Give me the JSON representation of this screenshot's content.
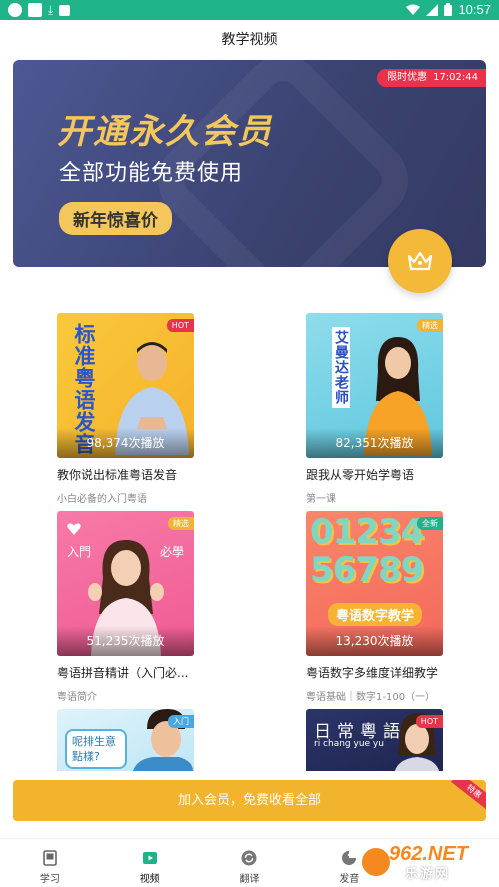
{
  "status_bar": {
    "time": "10:57",
    "left_icons": [
      "app-notification-icon",
      "square-notification-icon",
      "download-icon",
      "text-icon"
    ],
    "right_icons": [
      "wifi-icon",
      "signal-icon",
      "battery-icon"
    ]
  },
  "header": {
    "title": "教学视频"
  },
  "banner": {
    "title": "开通永久会员",
    "subtitle": "全部功能免费使用",
    "promo": "新年惊喜价",
    "timer_label": "限时优惠",
    "timer_value": "17:02:44",
    "fab_icon": "crown-icon"
  },
  "courses": [
    {
      "title": "教你说出标准粤语发音",
      "subtitle": "小白必备的入门粤语",
      "plays": "98,374次播放",
      "tag": "HOT",
      "thumb_text": "标准粤语发音"
    },
    {
      "title": "跟我从零开始学粤语",
      "subtitle": "第一课",
      "plays": "82,351次播放",
      "tag": "精选",
      "thumb_text": "艾曼达老师"
    },
    {
      "title": "粤语拼音精讲（入门必...",
      "subtitle": "粤语简介",
      "plays": "51,235次播放",
      "tag": "精选",
      "thumb_text_left": "入門",
      "thumb_text_right": "必學"
    },
    {
      "title": "粤语数字多维度详细教学",
      "subtitle": "粤语基础｜数字1-100（一）",
      "plays": "13,230次播放",
      "tag": "全新",
      "thumb_text": "粤语数字教学",
      "thumb_digits": "0123456789"
    },
    {
      "tag": "入门",
      "thumb_text": "呢排生意點樣?"
    },
    {
      "tag": "HOT",
      "thumb_text": "日常粵語",
      "thumb_subtext": "ri chang yue yu"
    }
  ],
  "join_bar": {
    "label": "加入会员，免费收看全部",
    "badge": "特惠"
  },
  "tabs": [
    {
      "label": "学习",
      "icon": "book-icon"
    },
    {
      "label": "视频",
      "icon": "video-icon",
      "active": true
    },
    {
      "label": "翻译",
      "icon": "translate-icon"
    },
    {
      "label": "发音",
      "icon": "pronunciation-icon"
    }
  ],
  "watermark": {
    "number": "962.NET",
    "text": "乐游网"
  },
  "colors": {
    "status_bar": "#1fb38a",
    "banner_bg": "#3f4878",
    "gold": "#f4c75c",
    "join_bar": "#f2b32d",
    "hot_tag": "#e8334a",
    "active_tab": "#1fb38a"
  }
}
